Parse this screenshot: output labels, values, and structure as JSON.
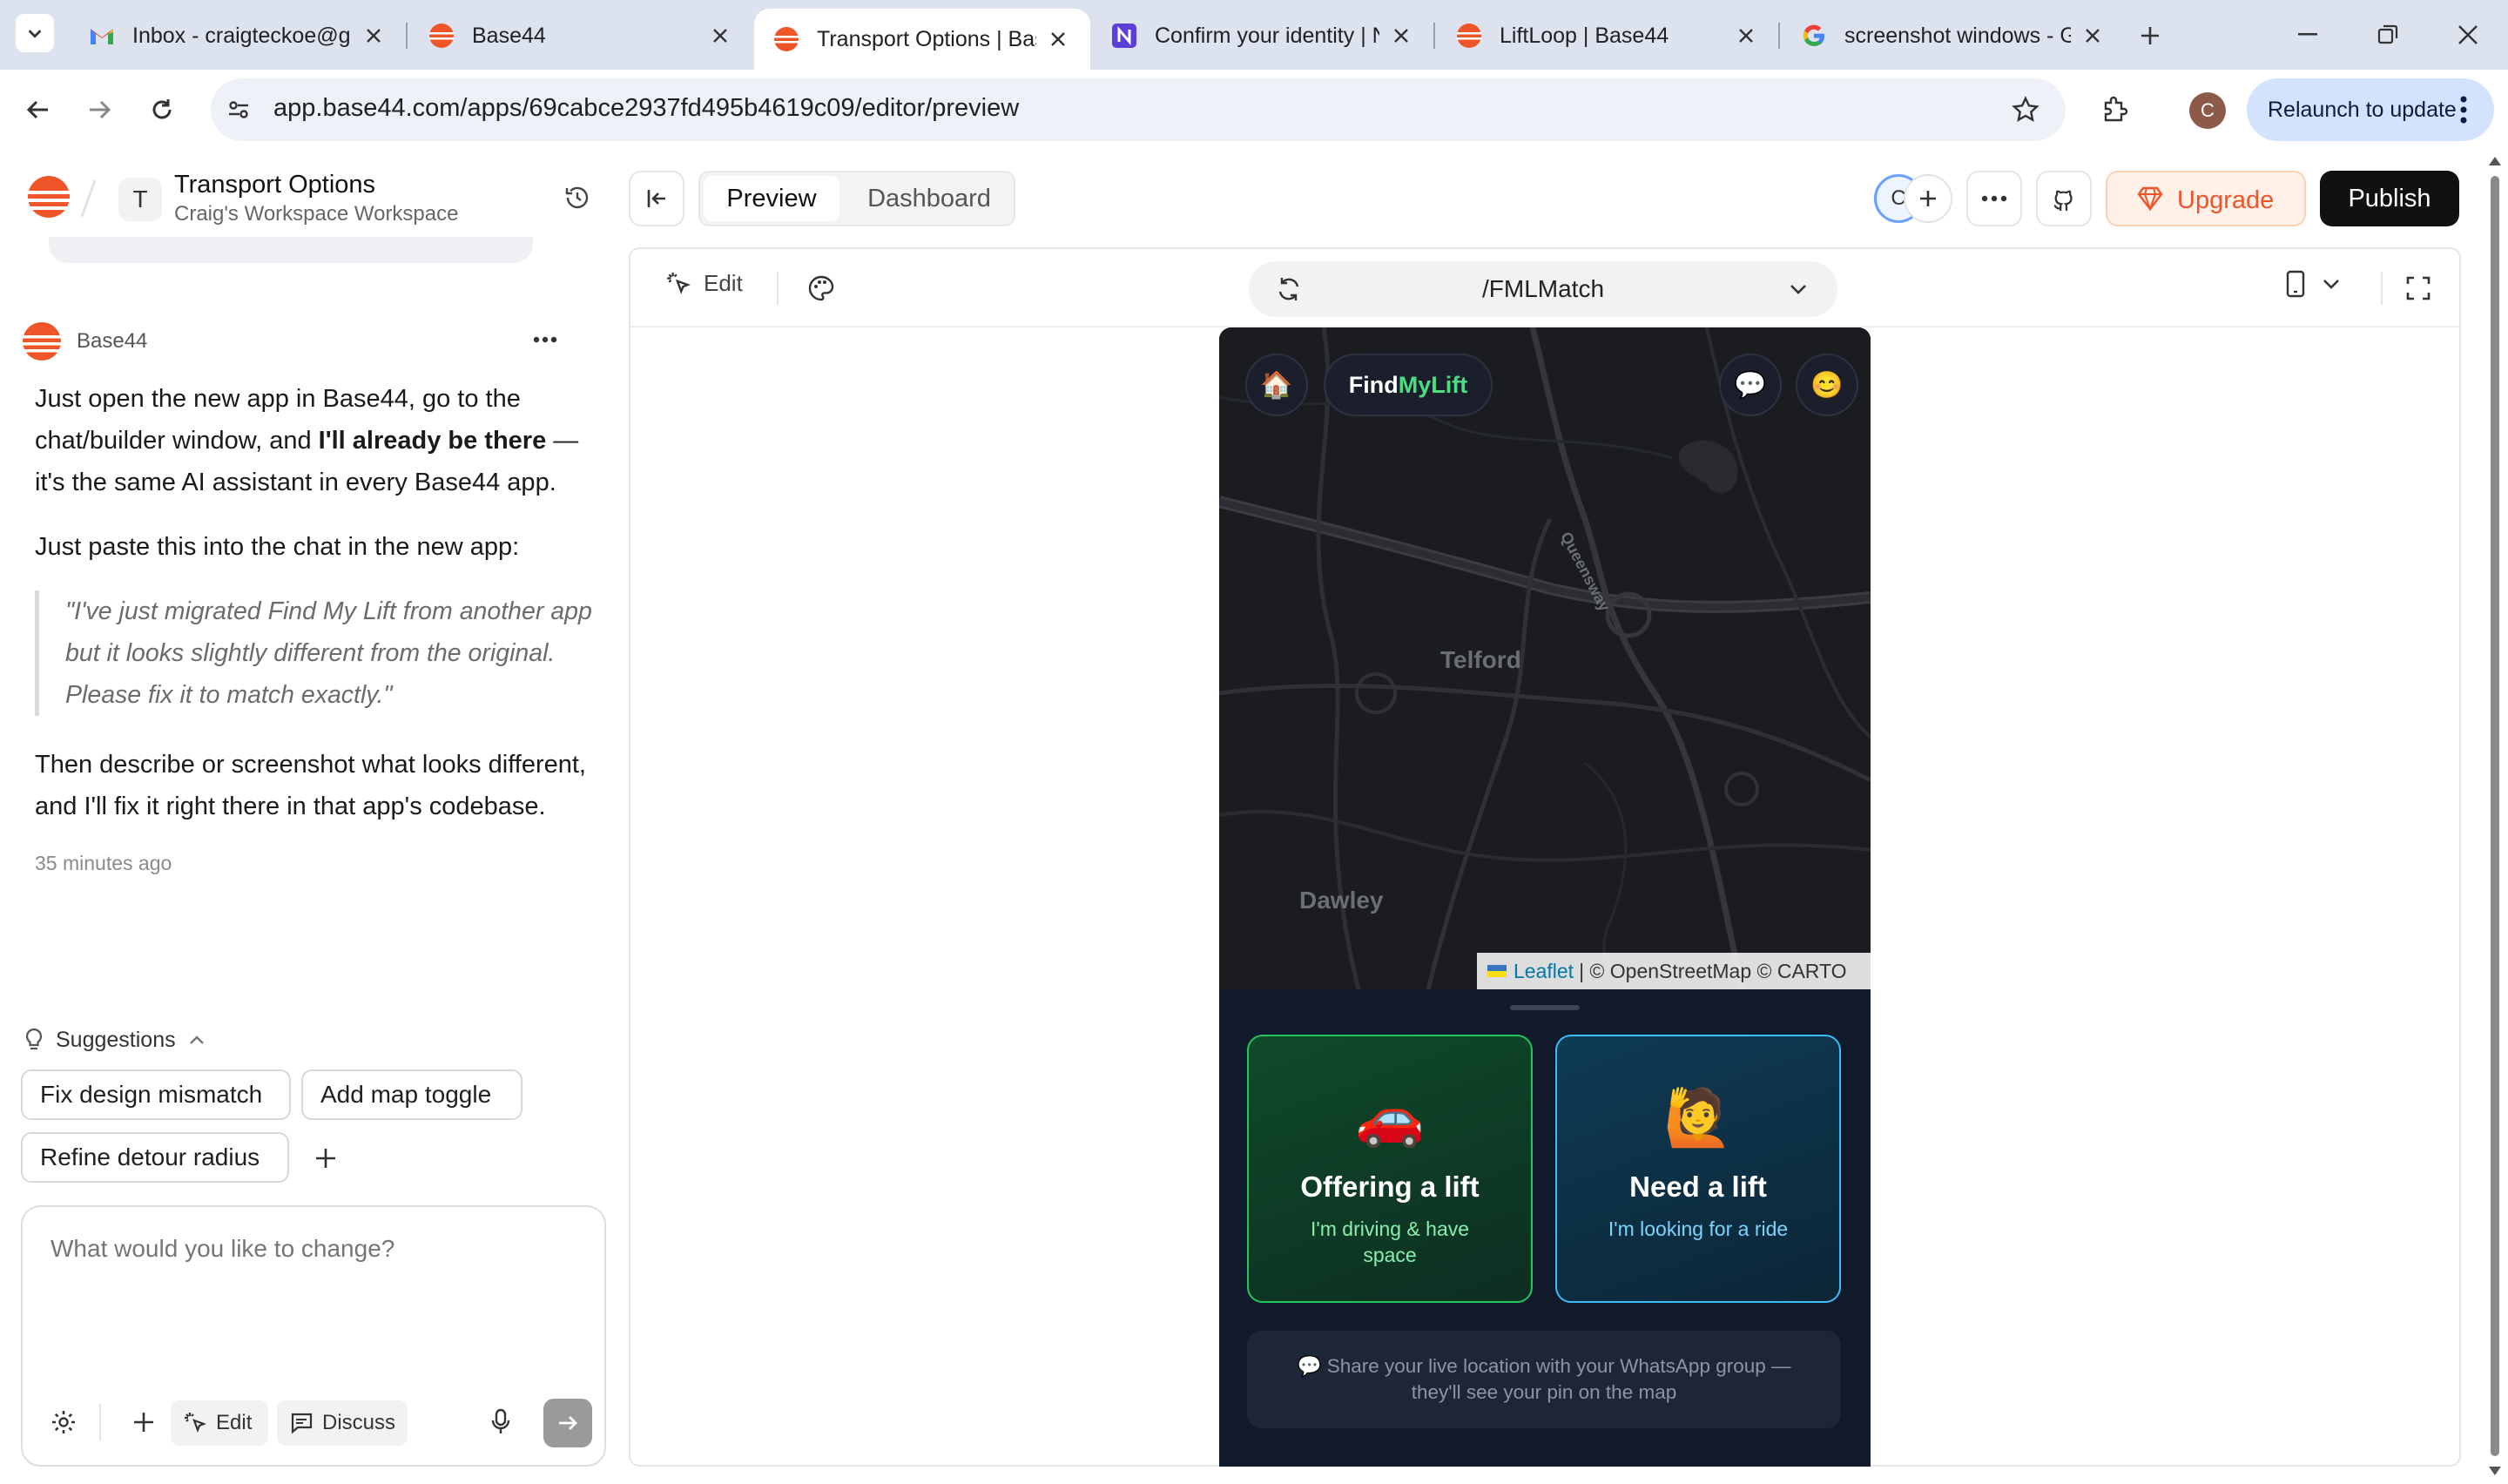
{
  "browser": {
    "tabs": [
      {
        "label": "Inbox - craigteckoe@gm",
        "icon": "gmail-icon",
        "active": false
      },
      {
        "label": "Base44",
        "icon": "base44-icon",
        "active": false
      },
      {
        "label": "Transport Options | Base",
        "icon": "base44-icon",
        "active": true
      },
      {
        "label": "Confirm your identity | N",
        "icon": "notion-icon",
        "active": false
      },
      {
        "label": "LiftLoop | Base44",
        "icon": "base44-icon",
        "active": false
      },
      {
        "label": "screenshot windows - G",
        "icon": "google-icon",
        "active": false
      }
    ],
    "url": "app.base44.com/apps/69cabce2937fd495b4619c09/editor/preview",
    "profile_initial": "C",
    "relaunch_label": "Relaunch to update"
  },
  "header": {
    "project_initial": "T",
    "project_title": "Transport Options",
    "workspace": "Craig's Workspace Workspace",
    "tabs": [
      "Preview",
      "Dashboard"
    ],
    "active_tab": "Preview",
    "collab_initial": "C",
    "upgrade_label": "Upgrade",
    "publish_label": "Publish",
    "accent": "#f0552a"
  },
  "chat": {
    "sender": "Base44",
    "msg_p1_a": "Just open the new app in Base44, go to the chat/builder window, and ",
    "msg_p1_bold": "I'll already be there",
    "msg_p1_b": " — it's the same AI assistant in every Base44 app.",
    "msg_p2": "Just paste this into the chat in the new app:",
    "quote": "\"I've just migrated Find My Lift from another app but it looks slightly different from the original. Please fix it to match exactly.\"",
    "msg_p3": "Then describe or screenshot what looks different, and I'll fix it right there in that app's codebase.",
    "timestamp": "35 minutes ago",
    "suggestions_label": "Suggestions",
    "suggestions": [
      "Fix design mismatch",
      "Add map toggle",
      "Refine detour radius"
    ],
    "composer_placeholder": "What would you like to change?",
    "edit_label": "Edit",
    "discuss_label": "Discuss"
  },
  "preview_toolbar": {
    "edit_label": "Edit",
    "route": "/FMLMatch"
  },
  "app": {
    "brand_find": "Find",
    "brand_mylift": "MyLift",
    "home_icon": "🏠",
    "chat_icon": "💬",
    "profile_icon": "😊",
    "map_labels": [
      "Telford",
      "Dawley",
      "Queensway"
    ],
    "attribution_link": "Leaflet",
    "attribution_rest": "| © OpenStreetMap © CARTO",
    "card_offer": {
      "emoji": "🚗",
      "title": "Offering a lift",
      "subtitle": "I'm driving & have space"
    },
    "card_need": {
      "emoji": "🙋",
      "title": "Need a lift",
      "subtitle": "I'm looking for a ride"
    },
    "share_text": "💬 Share your live location with your WhatsApp group — they'll see your pin on the map"
  }
}
